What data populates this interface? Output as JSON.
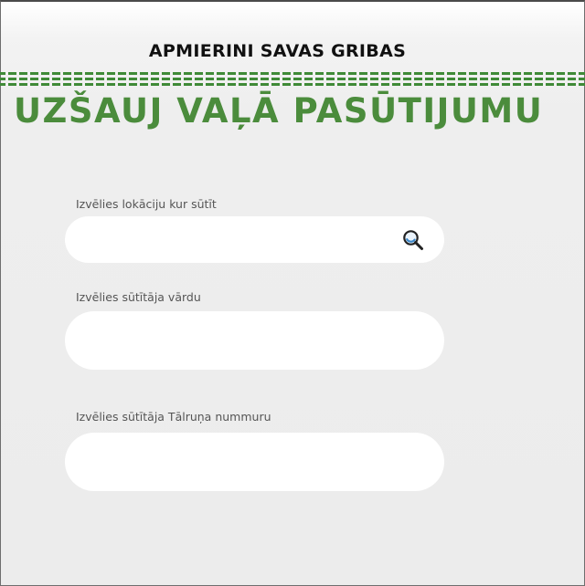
{
  "header": {
    "subtitle": "APMIERINI SAVAS GRIBAS",
    "headline": "UZŠAUJ VAĻĀ PASŪTIJUMU"
  },
  "form": {
    "location": {
      "label": "Izvēlies lokāciju kur sūtīt",
      "value": "",
      "placeholder": ""
    },
    "sender_name": {
      "label": "Izvēlies sūtītāja vārdu",
      "value": "",
      "placeholder": ""
    },
    "sender_phone": {
      "label": "Izvēlies sūtītāja Tālruņa nummuru",
      "value": "",
      "placeholder": ""
    }
  },
  "icons": {
    "search": "search-icon"
  },
  "colors": {
    "accent_green": "#4b8c3c",
    "stripe_green": "#3f8a37",
    "background": "#eeeeee",
    "field_background": "#ffffff",
    "subtitle_text": "#111111"
  }
}
